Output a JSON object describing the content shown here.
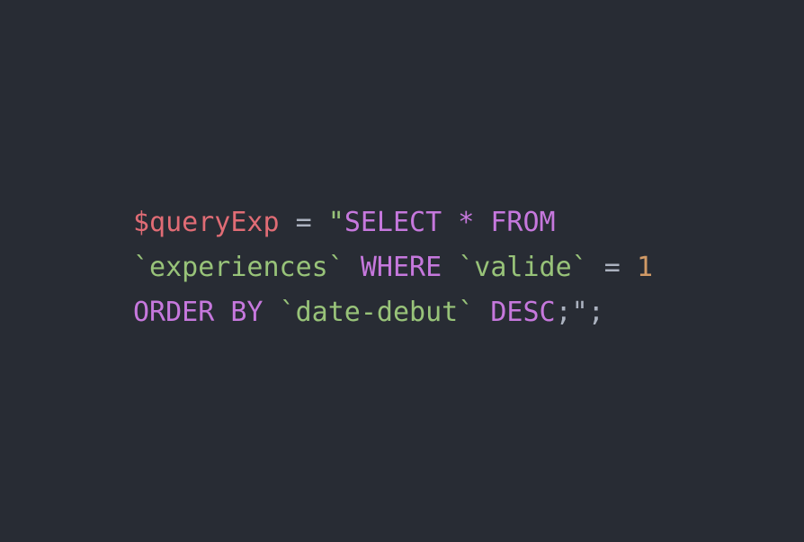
{
  "code": {
    "language": "php",
    "theme": {
      "background": "#282c34",
      "variable": "#e06c75",
      "operator": "#abb2bf",
      "string": "#98c379",
      "keyword": "#c678dd",
      "number": "#d19a66",
      "punctuation": "#abb2bf"
    },
    "lines": [
      [
        {
          "text": "$queryExp",
          "kind": "variable"
        },
        {
          "text": " = ",
          "kind": "operator"
        },
        {
          "text": "\"",
          "kind": "string"
        },
        {
          "text": "SELECT * FROM",
          "kind": "keyword"
        }
      ],
      [
        {
          "text": "`experiences`",
          "kind": "string"
        },
        {
          "text": " ",
          "kind": "operator"
        },
        {
          "text": "WHERE",
          "kind": "keyword"
        },
        {
          "text": " ",
          "kind": "operator"
        },
        {
          "text": "`valide`",
          "kind": "string"
        },
        {
          "text": " = ",
          "kind": "operator"
        },
        {
          "text": "1",
          "kind": "number"
        }
      ],
      [
        {
          "text": "ORDER BY",
          "kind": "keyword"
        },
        {
          "text": " ",
          "kind": "operator"
        },
        {
          "text": "`date-debut`",
          "kind": "string"
        },
        {
          "text": " ",
          "kind": "operator"
        },
        {
          "text": "DESC",
          "kind": "keyword"
        },
        {
          "text": ";\";",
          "kind": "punctuation"
        }
      ]
    ]
  }
}
